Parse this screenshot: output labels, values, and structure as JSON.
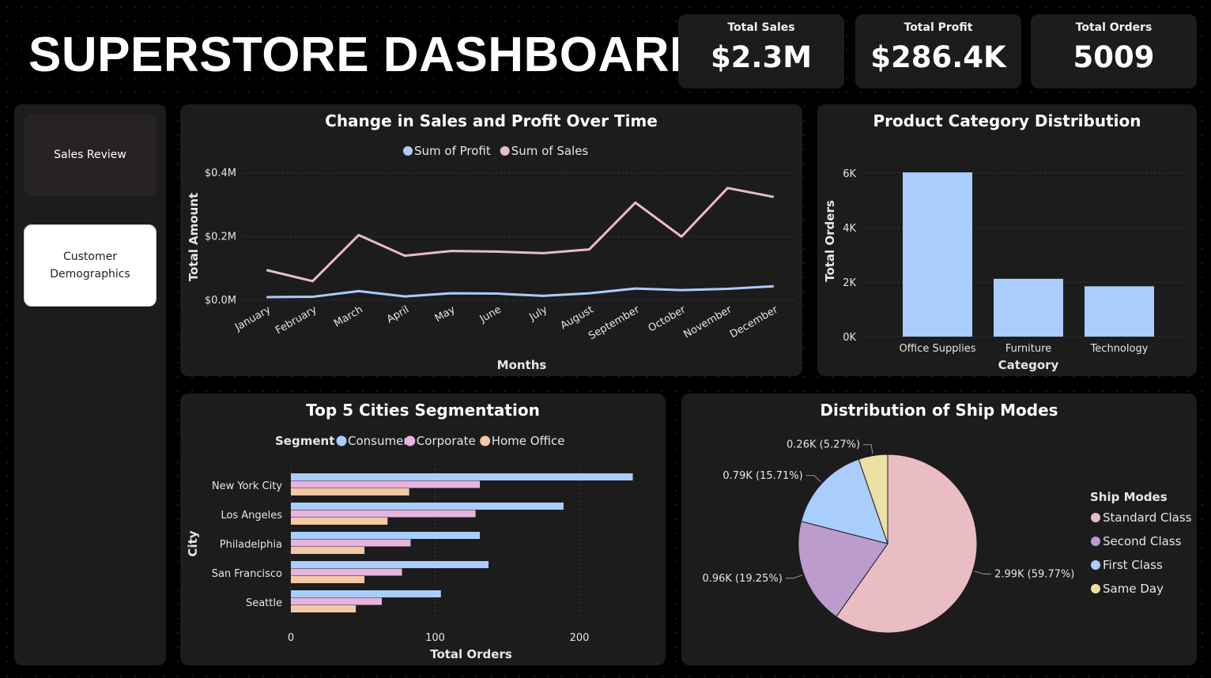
{
  "header": {
    "title": "SUPERSTORE DASHBOARD"
  },
  "kpis": [
    {
      "label": "Total Sales",
      "value": "$2.3M"
    },
    {
      "label": "Total Profit",
      "value": "$286.4K"
    },
    {
      "label": "Total Orders",
      "value": "5009"
    }
  ],
  "nav": {
    "sales_review": "Sales Review",
    "customer_demographics": "Customer Demographics"
  },
  "colors": {
    "blue": "#a9cdfc",
    "pink": "#eabcc3",
    "corporate": "#e7b4df",
    "home_office": "#f3c8a5",
    "second_class": "#bb9ccc",
    "same_day": "#ebe1a4"
  },
  "chart_data": [
    {
      "id": "sales_profit",
      "type": "line",
      "title": "Change in Sales and Profit Over Time",
      "xlabel": "Months",
      "ylabel": "Total Amount",
      "categories": [
        "January",
        "February",
        "March",
        "April",
        "May",
        "June",
        "July",
        "August",
        "September",
        "October",
        "November",
        "December"
      ],
      "series": [
        {
          "name": "Sum of Profit",
          "color": "#a9cdfc",
          "values": [
            0.01,
            0.011,
            0.029,
            0.012,
            0.022,
            0.021,
            0.014,
            0.022,
            0.037,
            0.032,
            0.036,
            0.044
          ]
        },
        {
          "name": "Sum of Sales",
          "color": "#eabcc3",
          "values": [
            0.095,
            0.06,
            0.205,
            0.14,
            0.155,
            0.153,
            0.148,
            0.16,
            0.307,
            0.2,
            0.353,
            0.325
          ]
        }
      ],
      "yticks": [
        "$0.0M",
        "$0.2M",
        "$0.4M"
      ],
      "ylim": [
        0,
        0.4
      ],
      "legend": "top-center",
      "grid": true
    },
    {
      "id": "category",
      "type": "bar",
      "title": "Product Category Distribution",
      "xlabel": "Category",
      "ylabel": "Total Orders",
      "categories": [
        "Office Supplies",
        "Furniture",
        "Technology"
      ],
      "values": [
        6026,
        2121,
        1847
      ],
      "yticks": [
        "0K",
        "2K",
        "4K",
        "6K"
      ],
      "ylim": [
        0,
        6000
      ],
      "color": "#a9cdfc",
      "grid": true
    },
    {
      "id": "cities",
      "type": "bar",
      "orientation": "horizontal",
      "title": "Top 5 Cities Segmentation",
      "xlabel": "Total Orders",
      "ylabel": "City",
      "legend_title": "Segment",
      "categories": [
        "New York City",
        "Los Angeles",
        "Philadelphia",
        "San Francisco",
        "Seattle"
      ],
      "series": [
        {
          "name": "Consumer",
          "color": "#a9cdfc",
          "values": [
            237,
            189,
            131,
            137,
            104
          ]
        },
        {
          "name": "Corporate",
          "color": "#e7b4df",
          "values": [
            131,
            128,
            83,
            77,
            63
          ]
        },
        {
          "name": "Home Office",
          "color": "#f3c8a5",
          "values": [
            82,
            67,
            51,
            51,
            45
          ]
        }
      ],
      "xticks": [
        "0",
        "100",
        "200"
      ],
      "xlim": [
        0,
        250
      ],
      "legend": "top-center",
      "grid": true
    },
    {
      "id": "ship_modes",
      "type": "pie",
      "title": "Distribution of Ship Modes",
      "legend_title": "Ship Modes",
      "legend": "right",
      "slices": [
        {
          "name": "Standard Class",
          "value": 59.77,
          "label": "2.99K (59.77%)",
          "color": "#eabcc3"
        },
        {
          "name": "Second Class",
          "value": 19.25,
          "label": "0.96K (19.25%)",
          "color": "#bb9ccc"
        },
        {
          "name": "First Class",
          "value": 15.71,
          "label": "0.79K (15.71%)",
          "color": "#a9cdfc"
        },
        {
          "name": "Same Day",
          "value": 5.27,
          "label": "0.26K (5.27%)",
          "color": "#ebe1a4"
        }
      ]
    }
  ]
}
